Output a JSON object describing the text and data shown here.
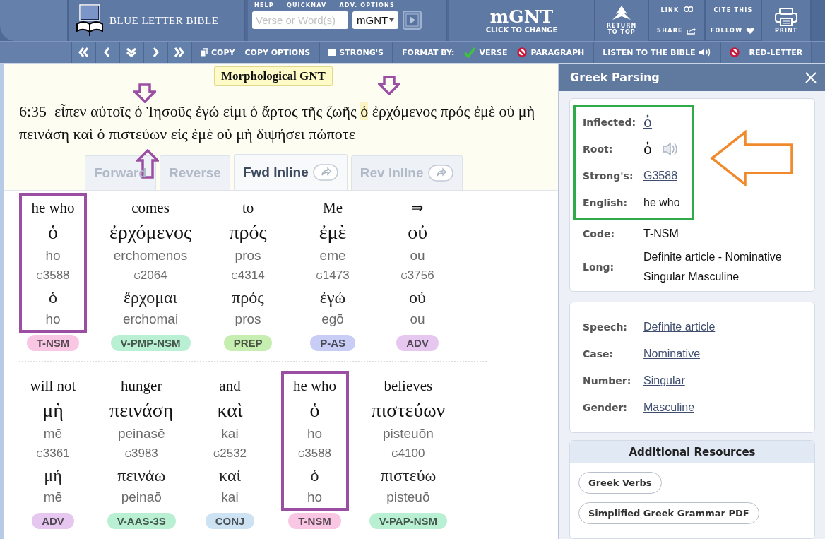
{
  "header": {
    "logo": "BLUE LETTER BIBLE",
    "quicknav_labels": [
      "HELP",
      "QUICKNAV",
      "ADV. OPTIONS"
    ],
    "search": {
      "placeholder": "Verse or Word(s)"
    },
    "version_select": "mGNT",
    "version_banner": {
      "title": "mGNT",
      "subtitle": "CLICK TO CHANGE"
    },
    "actions": [
      {
        "kind": "return",
        "label": "RETURN TO TOP"
      },
      {
        "kind": "pair",
        "items": [
          {
            "label": "LINK"
          },
          {
            "label": "SHARE"
          }
        ]
      },
      {
        "kind": "pair",
        "items": [
          {
            "label": "CITE THIS"
          },
          {
            "label": "FOLLOW"
          }
        ]
      },
      {
        "kind": "print",
        "label": "PRINT"
      }
    ]
  },
  "toolbar": {
    "groups": [
      [
        {
          "kind": "copy",
          "label": "COPY"
        },
        {
          "kind": "plain",
          "label": "COPY OPTIONS"
        }
      ],
      [
        {
          "kind": "checkbox",
          "label": "STRONG'S",
          "checked": false
        }
      ],
      [
        {
          "kind": "heading",
          "label": "FORMAT BY:"
        },
        {
          "kind": "option",
          "label": "VERSE",
          "selected": true
        },
        {
          "kind": "option",
          "label": "PARAGRAPH",
          "selected": false
        }
      ],
      [
        {
          "kind": "audio",
          "label": "LISTEN TO THE BIBLE"
        }
      ],
      [
        {
          "kind": "toggle",
          "label": "RED-LETTER",
          "on": false
        }
      ]
    ]
  },
  "translation_badge": "Morphological GNT",
  "verse": {
    "reference": "6:35",
    "text_before": "εἶπεν αὐτοῖς ὁ Ἰησοῦς ἐγώ εἰμι ὁ ἄρτος τῆς ζωῆς",
    "highlighted_word": "ὁ",
    "text_after": "ἐρχόμενος πρός ἐμὲ οὐ μὴ πεινάση καὶ ὁ πιστεύων εἰς ἐμὲ οὐ μὴ διψήσει πώποτε"
  },
  "tabs": [
    {
      "label": "Forward",
      "selected": false,
      "share": false
    },
    {
      "label": "Reverse",
      "selected": false,
      "share": false
    },
    {
      "label": "Fwd Inline",
      "selected": true,
      "share": true
    },
    {
      "label": "Rev Inline",
      "selected": false,
      "share": true
    }
  ],
  "interlinear": {
    "rows": [
      [
        {
          "english": "he who",
          "greek": "ὁ",
          "translit": "ho",
          "strongs": "G3588",
          "root": "ὁ",
          "root_translit": "ho",
          "tag": {
            "label": "T-NSM",
            "color": "#f9c6e3"
          },
          "outlined": true
        },
        {
          "english": "comes",
          "greek": "ἐρχόμενος",
          "translit": "erchomenos",
          "strongs": "G2064",
          "root": "ἔρχομαι",
          "root_translit": "erchomai",
          "tag": {
            "label": "V-PMP-NSM",
            "color": "#b9f0d3"
          },
          "outlined": false
        },
        {
          "english": "to",
          "greek": "πρός",
          "translit": "pros",
          "strongs": "G4314",
          "root": "πρός",
          "root_translit": "pros",
          "tag": {
            "label": "PREP",
            "color": "#c6eeb0"
          },
          "outlined": false
        },
        {
          "english": "Me",
          "greek": "ἐμὲ",
          "translit": "eme",
          "strongs": "G1473",
          "root": "ἐγώ",
          "root_translit": "egō",
          "tag": {
            "label": "P-AS",
            "color": "#c7cdf5"
          },
          "outlined": false
        },
        {
          "english": "⇒",
          "greek": "οὐ",
          "translit": "ou",
          "strongs": "G3756",
          "root": "οὐ",
          "root_translit": "ou",
          "tag": {
            "label": "ADV",
            "color": "#e6c7f0"
          },
          "outlined": false
        }
      ],
      [
        {
          "english": "will not",
          "greek": "μὴ",
          "translit": "mē",
          "strongs": "G3361",
          "root": "μή",
          "root_translit": "mē",
          "tag": {
            "label": "ADV",
            "color": "#e6c7f0"
          },
          "outlined": false
        },
        {
          "english": "hunger",
          "greek": "πεινάση",
          "translit": "peinasē",
          "strongs": "G3983",
          "root": "πεινάω",
          "root_translit": "peinaō",
          "tag": {
            "label": "V-AAS-3S",
            "color": "#b9f0d3"
          },
          "outlined": false
        },
        {
          "english": "and",
          "greek": "καὶ",
          "translit": "kai",
          "strongs": "G2532",
          "root": "καί",
          "root_translit": "kai",
          "tag": {
            "label": "CONJ",
            "color": "#cde2f2"
          },
          "outlined": false
        },
        {
          "english": "he who",
          "greek": "ὁ",
          "translit": "ho",
          "strongs": "G3588",
          "root": "ὁ",
          "root_translit": "ho",
          "tag": {
            "label": "T-NSM",
            "color": "#f9c6e3"
          },
          "outlined": true
        },
        {
          "english": "believes",
          "greek": "πιστεύων",
          "translit": "pisteuōn",
          "strongs": "G4100",
          "root": "πιστεύω",
          "root_translit": "pisteuō",
          "tag": {
            "label": "V-PAP-NSM",
            "color": "#b9f0d3"
          },
          "outlined": false
        }
      ]
    ]
  },
  "parsing_panel": {
    "title": "Greek Parsing",
    "details": [
      {
        "label": "Inflected:",
        "value": "ὁ",
        "kind": "greek-link",
        "highlighted": true
      },
      {
        "label": "Root:",
        "value": "ὁ",
        "kind": "greek-audio",
        "highlighted": true
      },
      {
        "label": "Strong's:",
        "value": "G3588",
        "kind": "link",
        "highlighted": true
      },
      {
        "label": "English:",
        "value": "he who",
        "kind": "text",
        "highlighted": true
      },
      {
        "label": "Code:",
        "value": "T-NSM",
        "kind": "text",
        "highlighted": false
      },
      {
        "label": "Long:",
        "value": "Definite article - Nominative Singular Masculine",
        "kind": "text",
        "highlighted": false
      }
    ],
    "grammar": [
      {
        "label": "Speech:",
        "value": "Definite article"
      },
      {
        "label": "Case:",
        "value": "Nominative"
      },
      {
        "label": "Number:",
        "value": "Singular"
      },
      {
        "label": "Gender:",
        "value": "Masculine"
      }
    ],
    "resources": {
      "title": "Additional Resources",
      "items": [
        "Greek Verbs",
        "Simplified Greek Grammar PDF"
      ]
    }
  }
}
